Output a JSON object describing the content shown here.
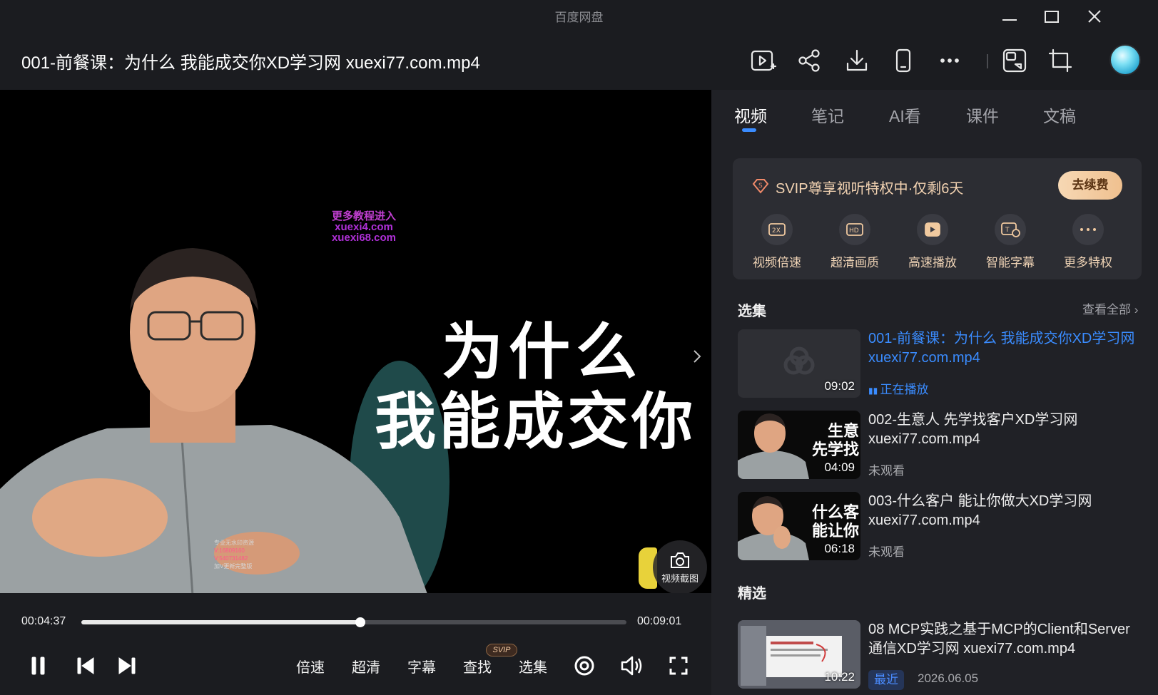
{
  "window": {
    "app_name": "百度网盘"
  },
  "header": {
    "file_title": "001-前餐课：为什么 我能成交你XD学习网 xuexi77.com.mp4"
  },
  "video": {
    "watermark": [
      "更多教程进入",
      "xuexi4.com",
      "xuexi68.com"
    ],
    "small_watermark": [
      "专业无水印资源",
      "V:16809160",
      "V:540731482",
      "加V更新完整版"
    ],
    "caption_line1": "为什么",
    "caption_line2": "我能成交你",
    "screenshot_label": "视频截图"
  },
  "player": {
    "current_time": "00:04:37",
    "total_time": "00:09:01",
    "progress": 0.512,
    "speed_label": "倍速",
    "quality_label": "超清",
    "subtitle_label": "字幕",
    "search_label": "查找",
    "search_badge": "SVIP",
    "episodes_label": "选集"
  },
  "panel": {
    "tabs": [
      {
        "label": "视频",
        "active": true
      },
      {
        "label": "笔记",
        "active": false
      },
      {
        "label": "AI看",
        "active": false
      },
      {
        "label": "课件",
        "active": false
      },
      {
        "label": "文稿",
        "active": false
      }
    ],
    "svip": {
      "title": "SVIP尊享视听特权中·仅剩6天",
      "renew_label": "去续费",
      "perks": [
        {
          "label": "视频倍速",
          "icon": "speed-2x-icon"
        },
        {
          "label": "超清画质",
          "icon": "hd-icon"
        },
        {
          "label": "高速播放",
          "icon": "fast-play-icon"
        },
        {
          "label": "智能字幕",
          "icon": "smart-subtitle-icon"
        },
        {
          "label": "更多特权",
          "icon": "more-icon"
        }
      ]
    },
    "episodes_title": "选集",
    "view_all": "查看全部",
    "episodes": [
      {
        "title": "001-前餐课：为什么 我能成交你XD学习网 xuexi77.com.mp4",
        "duration": "09:02",
        "status": "正在播放",
        "playing": true,
        "thumb_caption": ""
      },
      {
        "title": "002-生意人 先学找客户XD学习网 xuexi77.com.mp4",
        "duration": "04:09",
        "status": "未观看",
        "playing": false,
        "thumb_caption": "生意\n先学找"
      },
      {
        "title": "003-什么客户 能让你做大XD学习网 xuexi77.com.mp4",
        "duration": "06:18",
        "status": "未观看",
        "playing": false,
        "thumb_caption": "什么客\n能让你"
      }
    ],
    "featured_title": "精选",
    "featured": {
      "title": "08 MCP实践之基于MCP的Client和Server通信XD学习网 xuexi77.com.mp4",
      "duration": "10:22",
      "tag": "最近",
      "date": "2026.06.05"
    }
  },
  "colors": {
    "accent": "#3a8cff",
    "svip_gold": "#f0c99f",
    "background": "#1b1c20",
    "panel": "#202126"
  }
}
